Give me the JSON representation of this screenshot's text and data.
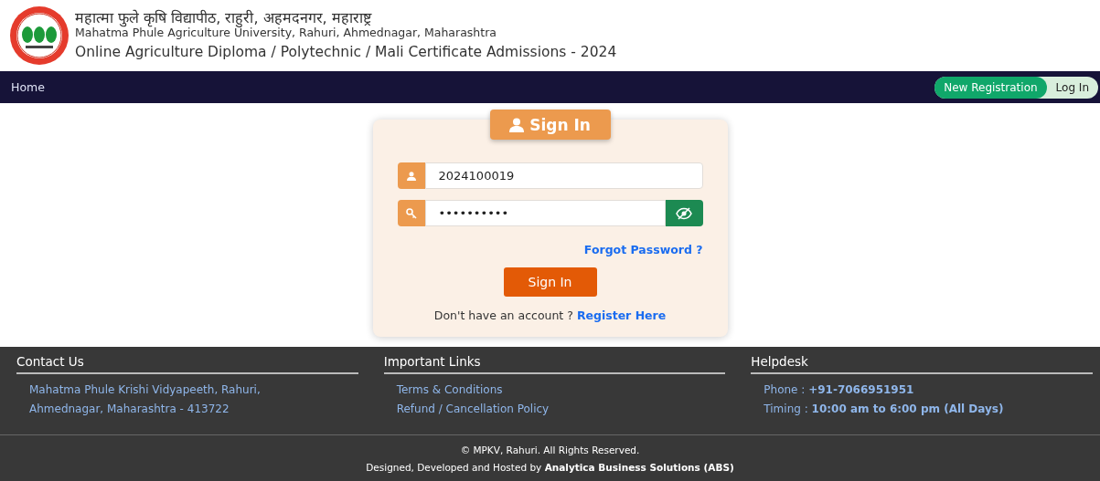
{
  "header": {
    "title_hindi": "महात्मा फुले कृषि विद्यापीठ, राहुरी, अहमदनगर, महाराष्ट्र",
    "title_english": "Mahatma Phule Agriculture University, Rahuri, Ahmednagar, Maharashtra",
    "subtitle": "Online Agriculture Diploma / Polytechnic / Mali Certificate Admissions - 2024"
  },
  "nav": {
    "home": "Home",
    "toggle": [
      {
        "label": "New Registration",
        "selected": true
      },
      {
        "label": "Log In",
        "selected": false
      }
    ]
  },
  "signin": {
    "heading": "Sign In",
    "username": "2024100019",
    "password": "••••••••••",
    "forgot": "Forgot Password ?",
    "button": "Sign In",
    "register_prompt": "Don't have an account ?",
    "register_link": "Register Here"
  },
  "footer": {
    "sections": [
      {
        "title": "Contact Us",
        "lines": [
          {
            "label": "Mahatma Phule Krishi Vidyapeeth, Rahuri,"
          },
          {
            "label": "Ahmednagar, Maharashtra - 413722"
          }
        ]
      },
      {
        "title": "Important Links",
        "lines": [
          {
            "label": "Terms & Conditions"
          },
          {
            "label": "Refund / Cancellation Policy"
          }
        ]
      },
      {
        "title": "Helpdesk",
        "lines": [
          {
            "label": "Phone :",
            "value": "+91-7066951951"
          },
          {
            "label": "Timing :",
            "value": "10:00 am to 6:00 pm (All Days)"
          }
        ]
      }
    ],
    "copyright": "© MPKV, Rahuri. All Rights Reserved.",
    "credit": "Designed, Developed and Hosted by **Analytica Business Solutions (ABS)**"
  }
}
